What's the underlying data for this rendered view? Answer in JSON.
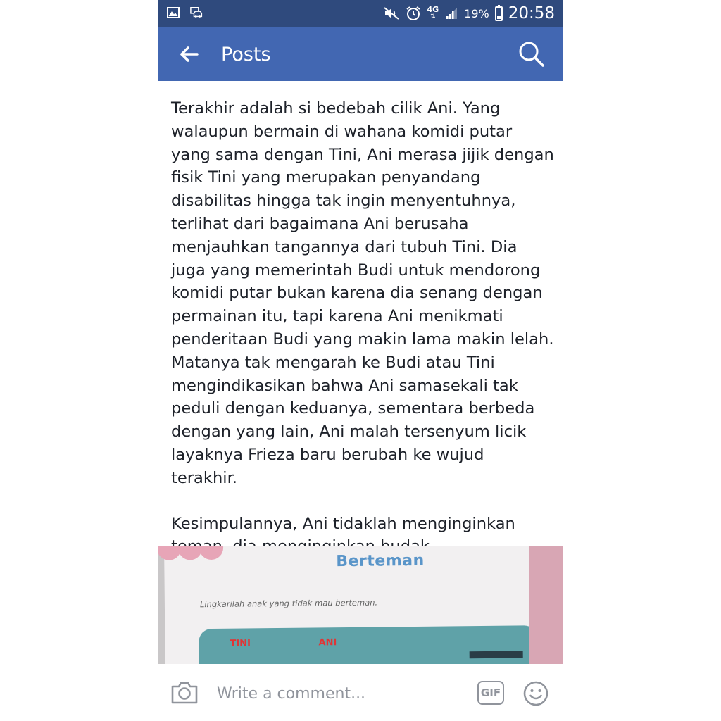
{
  "status_bar": {
    "battery_percent": "19%",
    "network": "4G",
    "time": "20:58",
    "icons": [
      "image-icon",
      "car-icon",
      "mute-icon",
      "alarm-icon",
      "signal-icon",
      "battery-icon"
    ]
  },
  "nav": {
    "title": "Posts",
    "back_icon": "back-arrow-icon",
    "search_icon": "search-icon"
  },
  "post": {
    "paragraphs": [
      "Terakhir adalah si bedebah cilik Ani. Yang walaupun bermain di wahana komidi putar yang sama dengan Tini, Ani merasa jijik dengan fisik Tini yang merupakan penyandang disabilitas hingga tak ingin menyentuhnya, terlihat dari bagaimana Ani berusaha menjauhkan tangannya dari tubuh Tini. Dia juga yang memerintah Budi untuk mendorong komidi putar bukan karena  dia senang dengan permainan itu, tapi karena Ani menikmati penderitaan Budi yang makin lama makin lelah. Matanya tak mengarah ke Budi atau Tini mengindikasikan bahwa Ani samasekali tak peduli dengan keduanya, sementara berbeda dengan yang lain, Ani malah tersenyum licik layaknya Frieza baru berubah ke wujud terakhir.",
      "Kesimpulannya, Ani tidaklah menginginkan teman, dia menginginkan budak."
    ],
    "image": {
      "title": "Berteman",
      "instruction": "Lingkarilah anak yang tidak mau berteman.",
      "names": [
        "TINI",
        "ANI"
      ]
    }
  },
  "comment_bar": {
    "placeholder": "Write a comment...",
    "gif_label": "GIF",
    "camera_icon": "camera-icon",
    "emoji_icon": "emoji-icon"
  },
  "colors": {
    "status_bar": "#2f4a7d",
    "nav_bar": "#4267b2",
    "text": "#1d2129",
    "muted": "#90949c"
  }
}
